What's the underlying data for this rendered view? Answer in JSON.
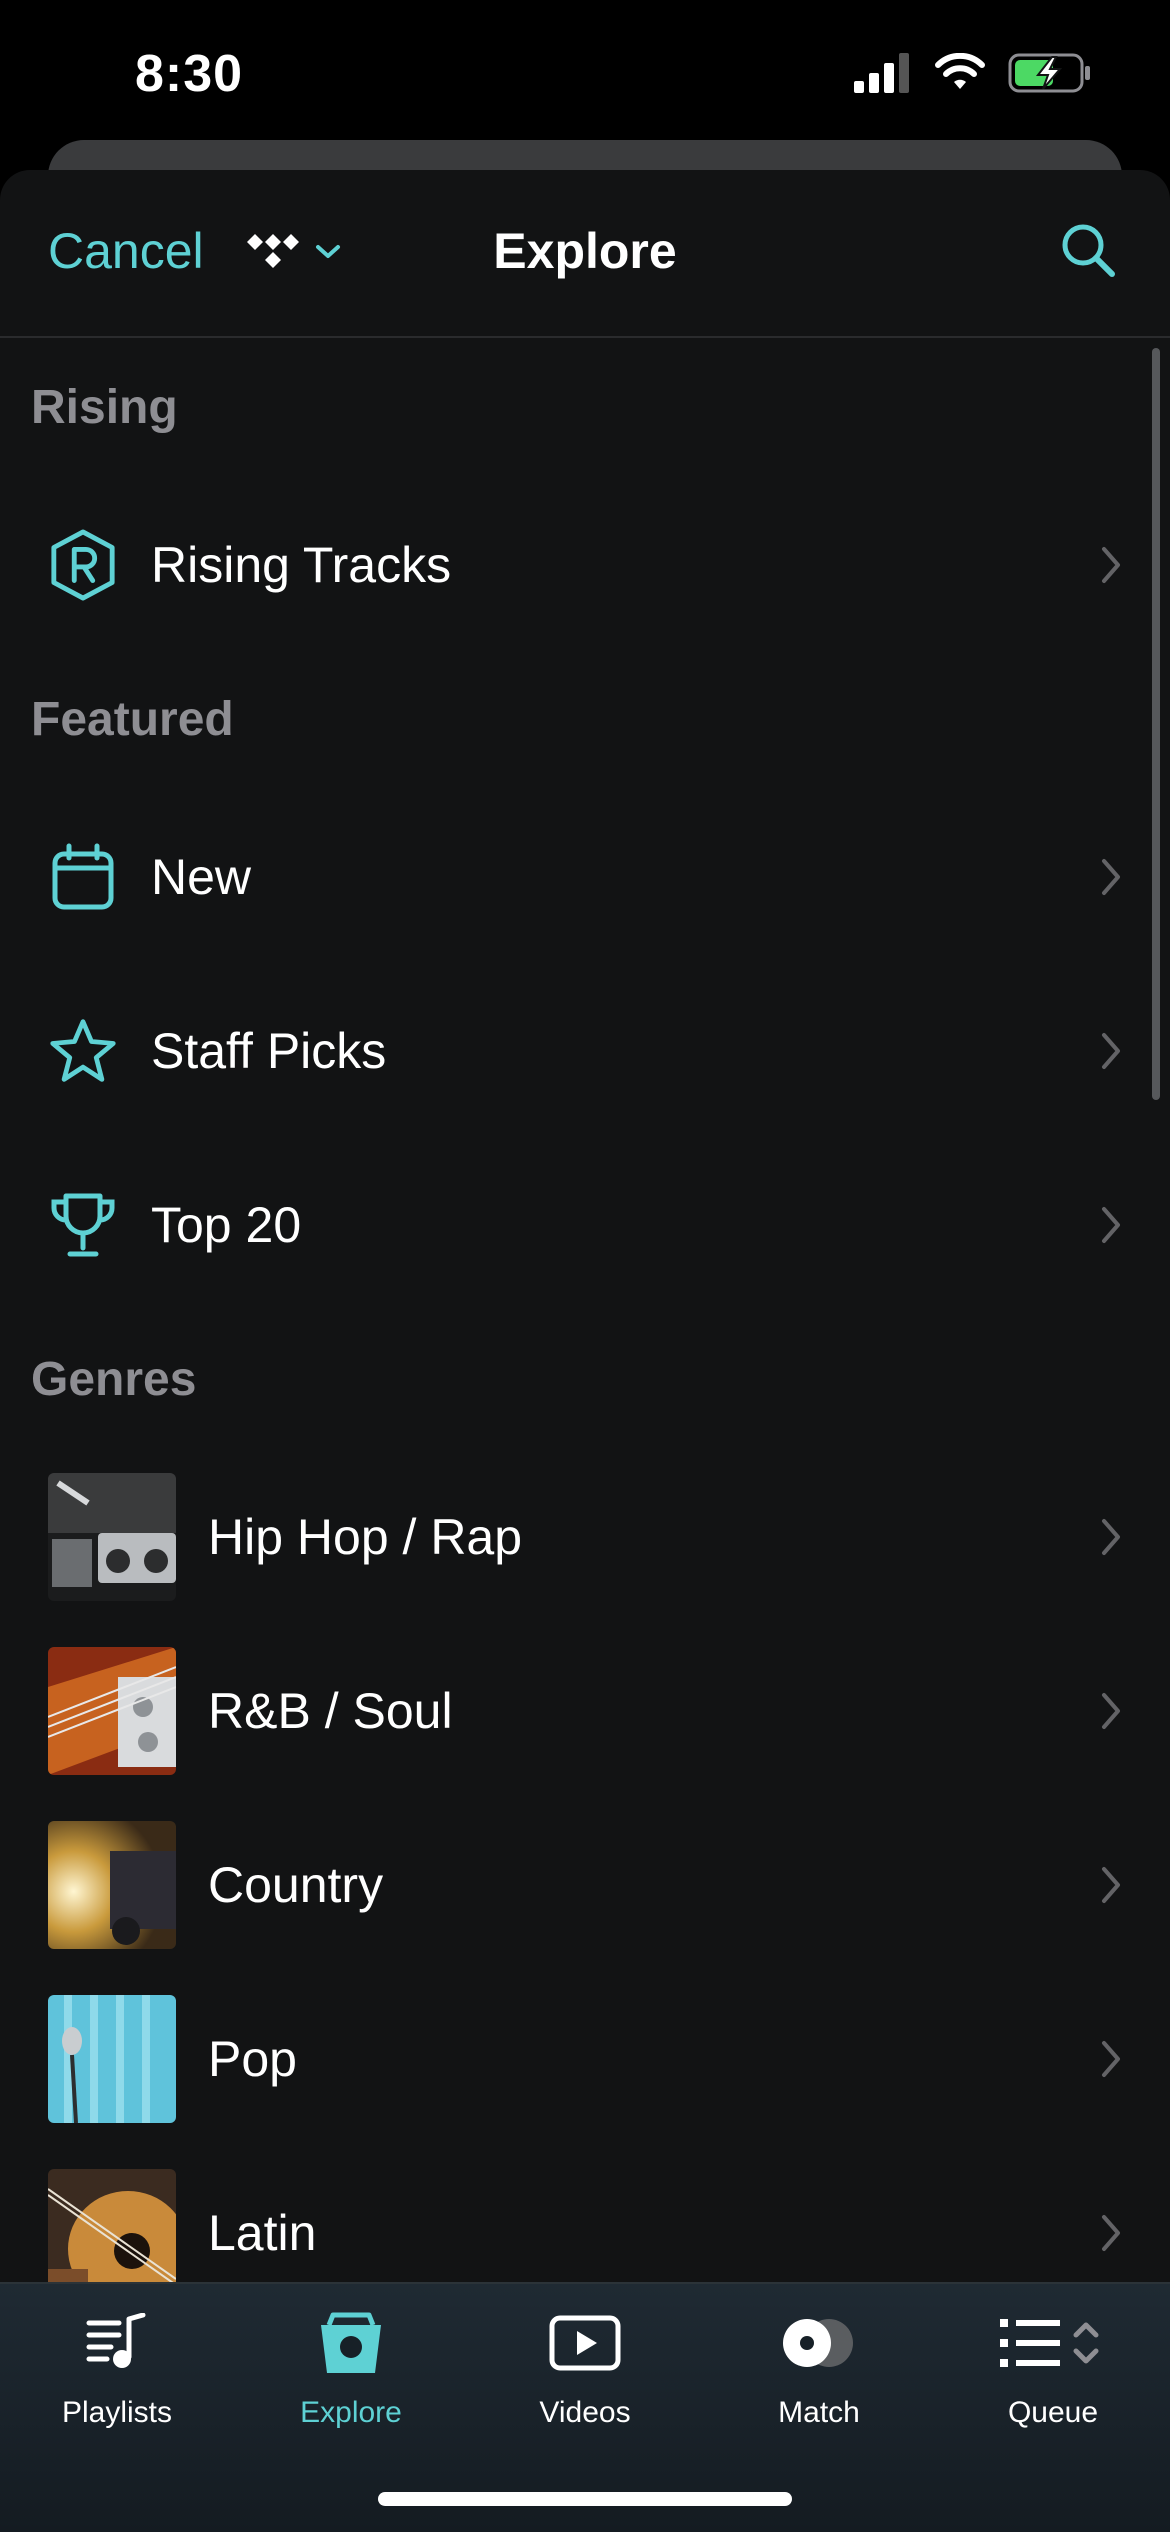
{
  "status": {
    "time": "8:30"
  },
  "nav": {
    "cancel_label": "Cancel",
    "title": "Explore",
    "source_icon": "tidal-logo-icon",
    "search_icon": "search-icon"
  },
  "sections": {
    "rising": {
      "title": "Rising",
      "items": [
        {
          "label": "Rising Tracks",
          "icon": "rising-r-icon"
        }
      ]
    },
    "featured": {
      "title": "Featured",
      "items": [
        {
          "label": "New",
          "icon": "calendar-icon"
        },
        {
          "label": "Staff Picks",
          "icon": "star-icon"
        },
        {
          "label": "Top 20",
          "icon": "trophy-icon"
        }
      ]
    },
    "genres": {
      "title": "Genres",
      "items": [
        {
          "label": "Hip Hop / Rap",
          "thumb": "boombox-thumb"
        },
        {
          "label": "R&B / Soul",
          "thumb": "bass-guitar-thumb"
        },
        {
          "label": "Country",
          "thumb": "truck-sunset-thumb"
        },
        {
          "label": "Pop",
          "thumb": "microphone-thumb"
        },
        {
          "label": "Latin",
          "thumb": "acoustic-guitar-thumb"
        }
      ]
    }
  },
  "tabbar": {
    "active": "Explore",
    "tabs": [
      {
        "label": "Playlists",
        "icon": "playlists-icon"
      },
      {
        "label": "Explore",
        "icon": "explore-icon"
      },
      {
        "label": "Videos",
        "icon": "videos-icon"
      },
      {
        "label": "Match",
        "icon": "match-icon"
      },
      {
        "label": "Queue",
        "icon": "queue-icon"
      }
    ]
  },
  "colors": {
    "accent": "#5ed1d4",
    "background": "#121314",
    "section_header": "#8e8e93"
  }
}
